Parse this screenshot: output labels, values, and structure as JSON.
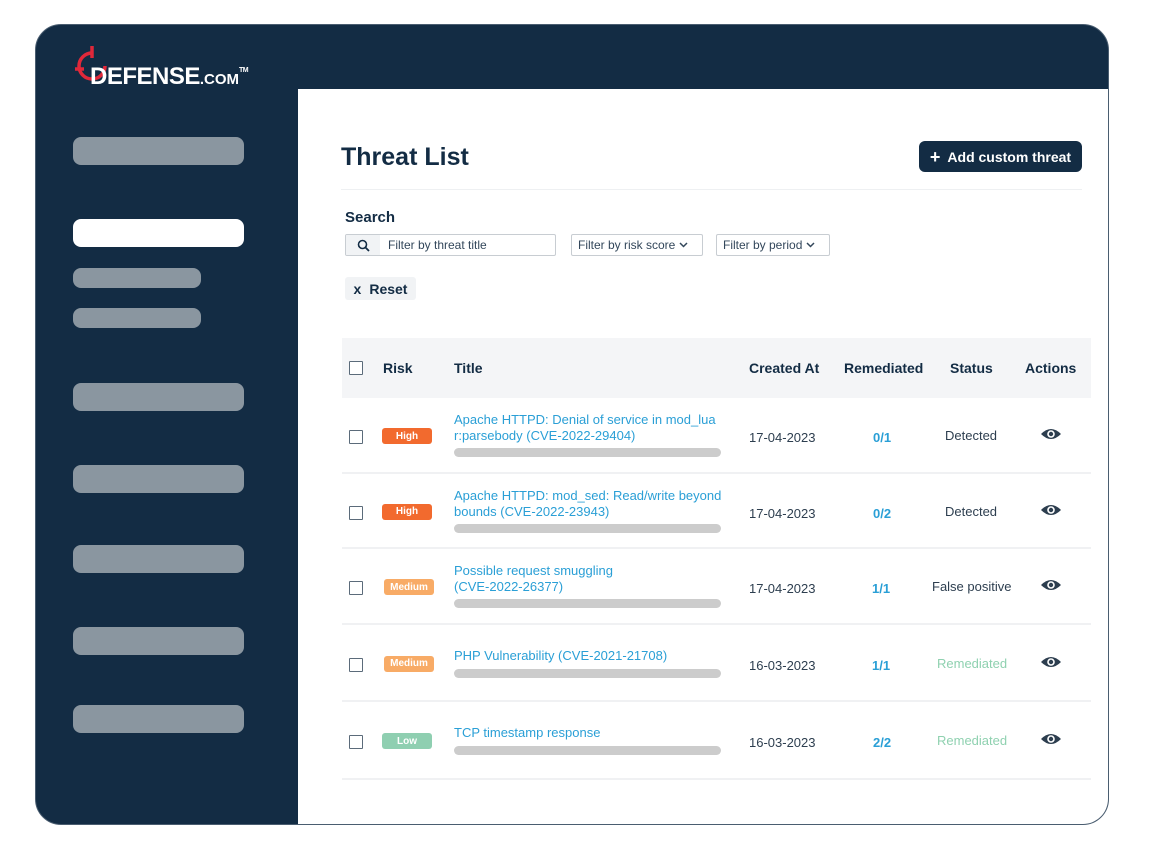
{
  "brand": {
    "name": "DEFENSE",
    "suffix": ".COM",
    "trademark": "TM",
    "accent": "#e0283a",
    "navy": "#132c44"
  },
  "sidebar": {
    "items": [
      {
        "id": "placeholder-1",
        "active": false
      },
      {
        "id": "placeholder-2",
        "active": true
      },
      {
        "id": "placeholder-3",
        "active": false
      },
      {
        "id": "placeholder-4",
        "active": false
      },
      {
        "id": "placeholder-5",
        "active": false
      },
      {
        "id": "placeholder-6",
        "active": false
      },
      {
        "id": "placeholder-7",
        "active": false
      },
      {
        "id": "placeholder-8",
        "active": false
      },
      {
        "id": "placeholder-9",
        "active": false
      }
    ]
  },
  "header": {
    "title": "Threat List",
    "add_button": {
      "icon": "plus-icon",
      "label": "Add custom threat"
    }
  },
  "filters": {
    "search_label": "Search",
    "search_placeholder": "Filter by threat title",
    "risk_select": "Filter by risk score",
    "period_select": "Filter by period",
    "reset_icon": "x",
    "reset_label": "Reset"
  },
  "table": {
    "columns": [
      "Risk",
      "Title",
      "Created At",
      "Remediated",
      "Status",
      "Actions"
    ],
    "rows": [
      {
        "risk": "High",
        "title_line1": "Apache HTTPD: Denial of service in mod_lua",
        "title_line2": "r:parsebody (CVE-2022-29404)",
        "created": "17-04-2023",
        "remediated": "0/1",
        "status": "Detected"
      },
      {
        "risk": "High",
        "title_line1": "Apache HTTPD: mod_sed: Read/write beyond",
        "title_line2": "bounds (CVE-2022-23943)",
        "created": "17-04-2023",
        "remediated": "0/2",
        "status": "Detected"
      },
      {
        "risk": "Medium",
        "title_line1": "Possible request smuggling",
        "title_line2": "(CVE-2022-26377)",
        "created": "17-04-2023",
        "remediated": "1/1",
        "status": "False positive"
      },
      {
        "risk": "Medium",
        "title_line1": "PHP Vulnerability (CVE-2021-21708)",
        "title_line2": "",
        "created": "16-03-2023",
        "remediated": "1/1",
        "status": "Remediated"
      },
      {
        "risk": "Low",
        "title_line1": "TCP timestamp response",
        "title_line2": "",
        "created": "16-03-2023",
        "remediated": "2/2",
        "status": "Remediated"
      }
    ]
  },
  "colors": {
    "high": "#f26a2e",
    "medium": "#f8ab66",
    "low": "#8fcfb1",
    "link": "#2a9fd6",
    "remediated_status": "#8fd1b0"
  }
}
